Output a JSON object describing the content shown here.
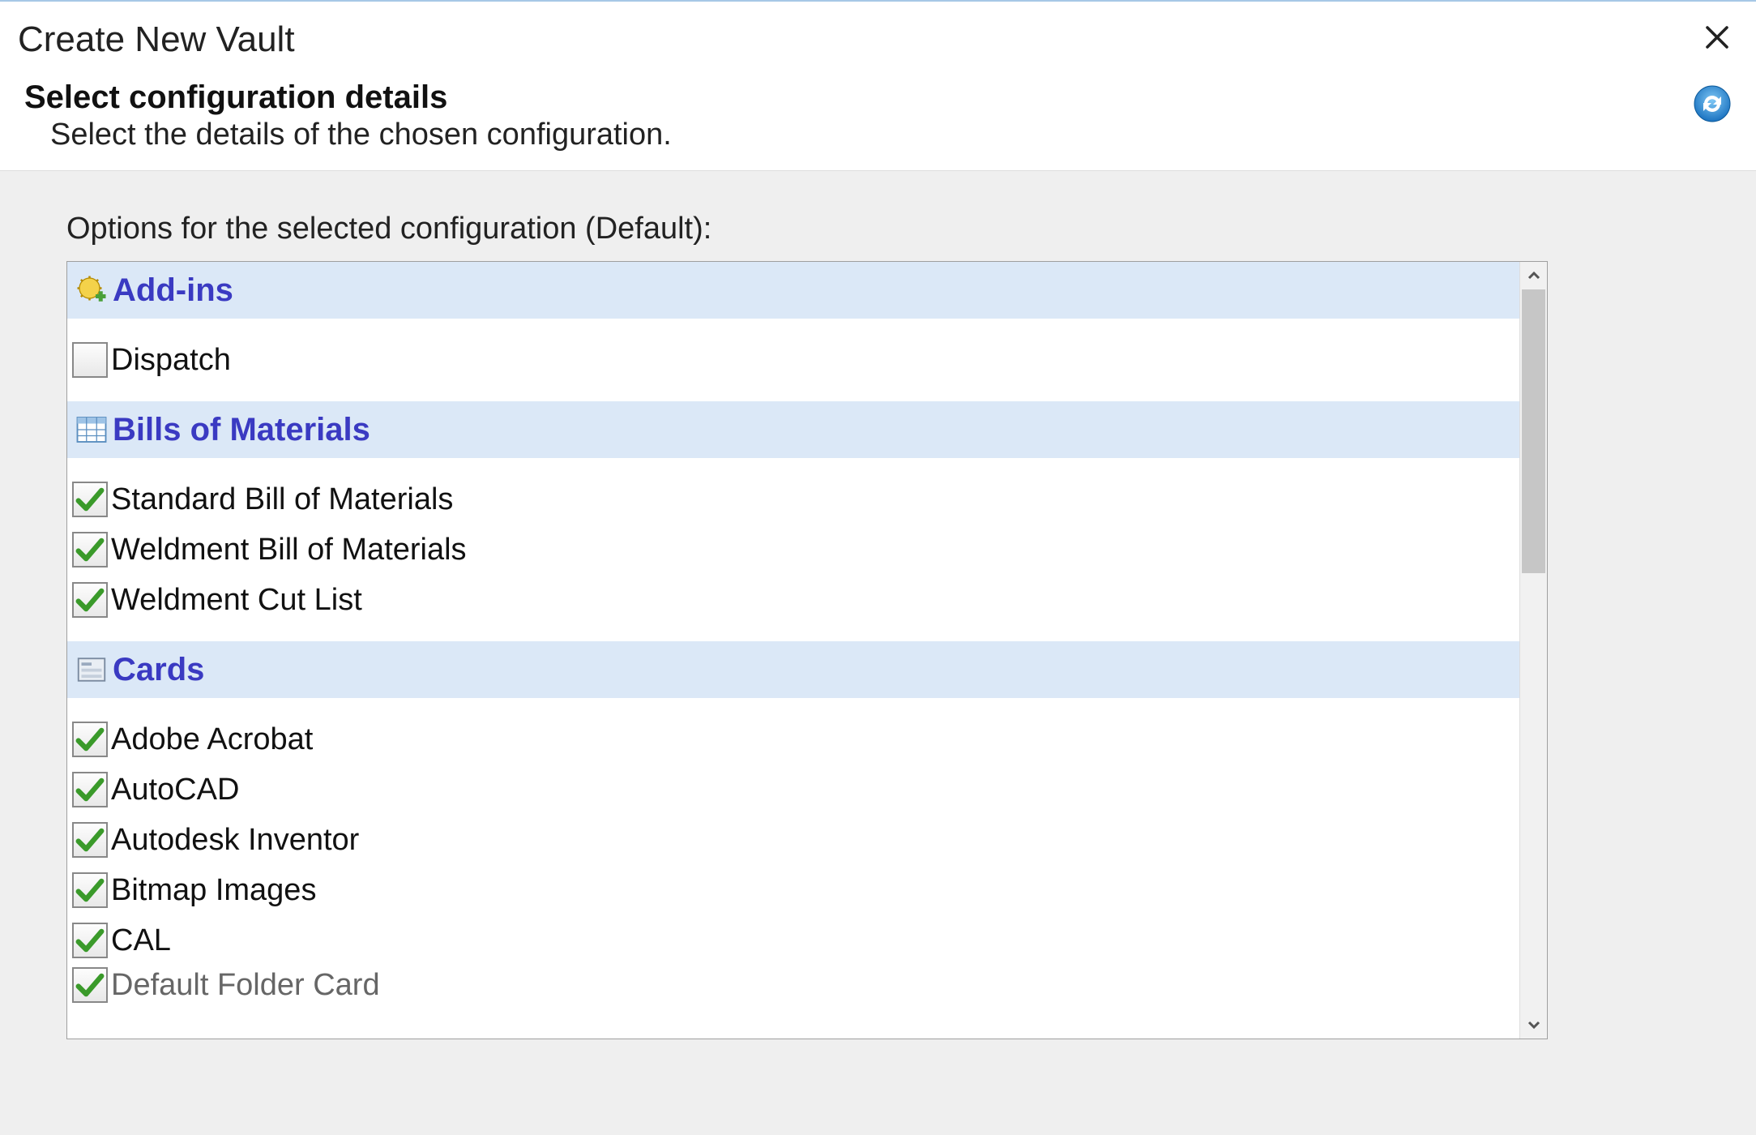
{
  "dialog": {
    "title": "Create New Vault",
    "header_title": "Select configuration details",
    "header_subtitle": "Select the details of the chosen configuration.",
    "options_label": "Options for the selected configuration (Default):"
  },
  "groups": [
    {
      "icon": "addins-icon",
      "title": "Add-ins",
      "items": [
        {
          "label": "Dispatch",
          "checked": false
        }
      ]
    },
    {
      "icon": "table-icon",
      "title": "Bills of Materials",
      "items": [
        {
          "label": "Standard Bill of Materials",
          "checked": true
        },
        {
          "label": "Weldment Bill of Materials",
          "checked": true
        },
        {
          "label": "Weldment Cut List",
          "checked": true
        }
      ]
    },
    {
      "icon": "cards-icon",
      "title": "Cards",
      "items": [
        {
          "label": "Adobe Acrobat",
          "checked": true
        },
        {
          "label": "AutoCAD",
          "checked": true
        },
        {
          "label": "Autodesk Inventor",
          "checked": true
        },
        {
          "label": "Bitmap Images",
          "checked": true
        },
        {
          "label": "CAL",
          "checked": true
        },
        {
          "label": "Default Folder Card",
          "checked": true
        }
      ]
    }
  ]
}
